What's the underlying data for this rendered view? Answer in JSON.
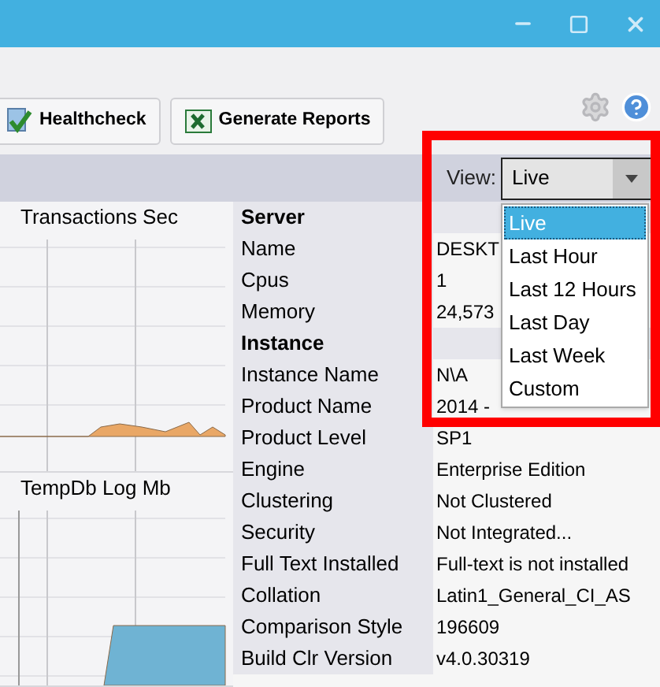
{
  "toolbar": {
    "buttons": [
      {
        "label": "Healthcheck",
        "kind": "healthcheck"
      },
      {
        "label": "Generate Reports",
        "kind": "excel"
      }
    ]
  },
  "view": {
    "label": "View:",
    "value": "Live",
    "expanded": true,
    "options": [
      {
        "label": "Live",
        "selected": true
      },
      {
        "label": "Last Hour",
        "selected": false
      },
      {
        "label": "Last 12 Hours",
        "selected": false
      },
      {
        "label": "Last Day",
        "selected": false
      },
      {
        "label": "Last Week",
        "selected": false
      },
      {
        "label": "Custom",
        "selected": false
      }
    ]
  },
  "charts": [
    {
      "title": "Transactions Sec",
      "color": "#e9a766"
    },
    {
      "title": "TempDb Log Mb",
      "color": "#6fb3d3"
    }
  ],
  "properties": [
    {
      "kind": "section",
      "label": "Server"
    },
    {
      "kind": "row",
      "label": "Name",
      "value": "DESKT"
    },
    {
      "kind": "row",
      "label": "Cpus",
      "value": "1"
    },
    {
      "kind": "row",
      "label": "Memory",
      "value": "24,573"
    },
    {
      "kind": "section",
      "label": "Instance"
    },
    {
      "kind": "row",
      "label": "Instance Name",
      "value": "N\\A"
    },
    {
      "kind": "row",
      "label": "Product Name",
      "value": "2014 -"
    },
    {
      "kind": "row",
      "label": "Product Level",
      "value": "SP1"
    },
    {
      "kind": "row",
      "label": "Engine",
      "value": "Enterprise Edition"
    },
    {
      "kind": "row",
      "label": "Clustering",
      "value": "Not Clustered"
    },
    {
      "kind": "row",
      "label": "Security",
      "value": "Not Integrated..."
    },
    {
      "kind": "row",
      "label": "Full Text Installed",
      "value": "Full-text is not installed"
    },
    {
      "kind": "row",
      "label": "Collation",
      "value": "Latin1_General_CI_AS"
    },
    {
      "kind": "row",
      "label": "Comparison Style",
      "value": "196609"
    },
    {
      "kind": "row",
      "label": "Build Clr Version",
      "value": "v4.0.30319"
    }
  ]
}
